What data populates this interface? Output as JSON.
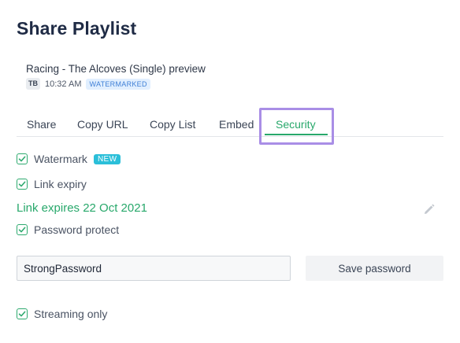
{
  "title": "Share Playlist",
  "track": {
    "name": "Racing - The Alcoves (Single) preview",
    "avatar_initials": "TB",
    "time": "10:32 AM",
    "badge": "WATERMARKED"
  },
  "tabs": [
    {
      "label": "Share",
      "active": false
    },
    {
      "label": "Copy URL",
      "active": false
    },
    {
      "label": "Copy List",
      "active": false
    },
    {
      "label": "Embed",
      "active": false
    },
    {
      "label": "Security",
      "active": true
    }
  ],
  "security": {
    "watermark": {
      "label": "Watermark",
      "checked": true,
      "badge": "NEW"
    },
    "link_expiry": {
      "label": "Link expiry",
      "checked": true
    },
    "expiry_text": "Link expires 22 Oct 2021",
    "password_protect": {
      "label": "Password protect",
      "checked": true
    },
    "password_value": "StrongPassword",
    "save_password_label": "Save password",
    "streaming_only": {
      "label": "Streaming only",
      "checked": true
    }
  },
  "colors": {
    "accent": "#28a86b",
    "highlight": "#a98ee6",
    "new_badge": "#2bbfd9",
    "watermarked_badge_bg": "#e1efff"
  },
  "icons": {
    "checkbox": "check-icon",
    "edit": "pencil-icon"
  }
}
